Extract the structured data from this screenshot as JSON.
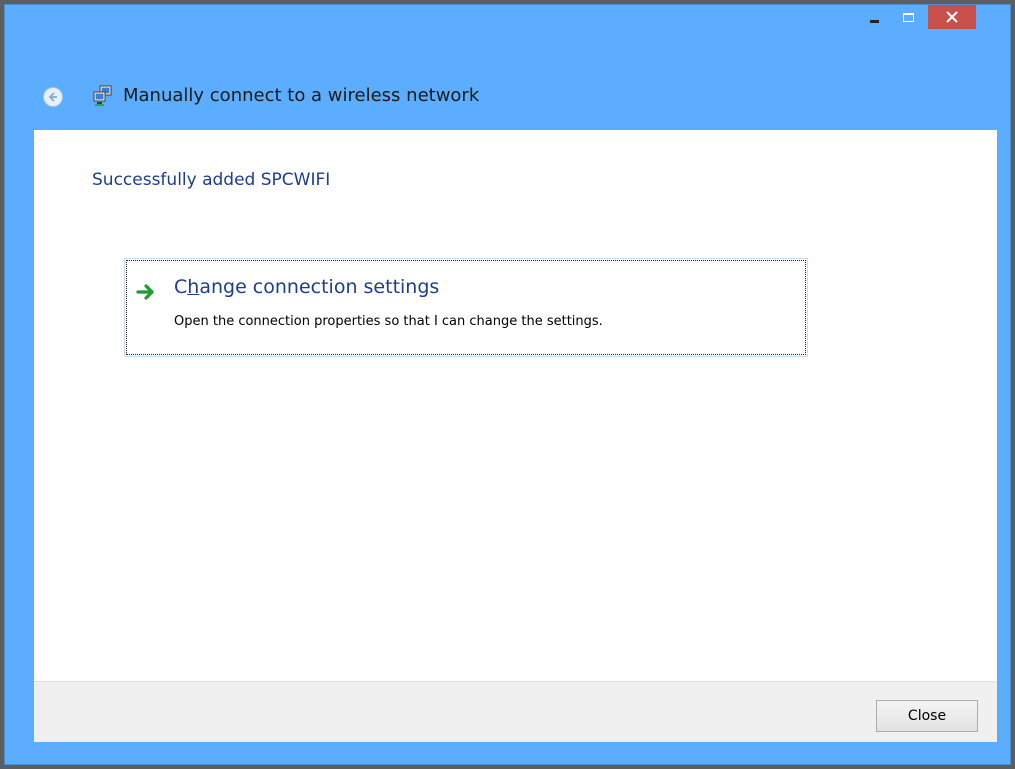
{
  "window": {
    "title": "Manually connect to a wireless network",
    "caption_buttons": [
      "minimize",
      "maximize",
      "close"
    ]
  },
  "content": {
    "heading": "Successfully added SPCWIFI",
    "command_link": {
      "label_before_accel": "C",
      "label_accel": "h",
      "label_after_accel": "ange connection settings",
      "description": "Open the connection properties so that I can change the settings."
    }
  },
  "footer": {
    "close_label": "Close"
  },
  "colors": {
    "title_bar": "#5cadff",
    "heading": "#1e3d8a",
    "close_caption": "#c7504b"
  }
}
